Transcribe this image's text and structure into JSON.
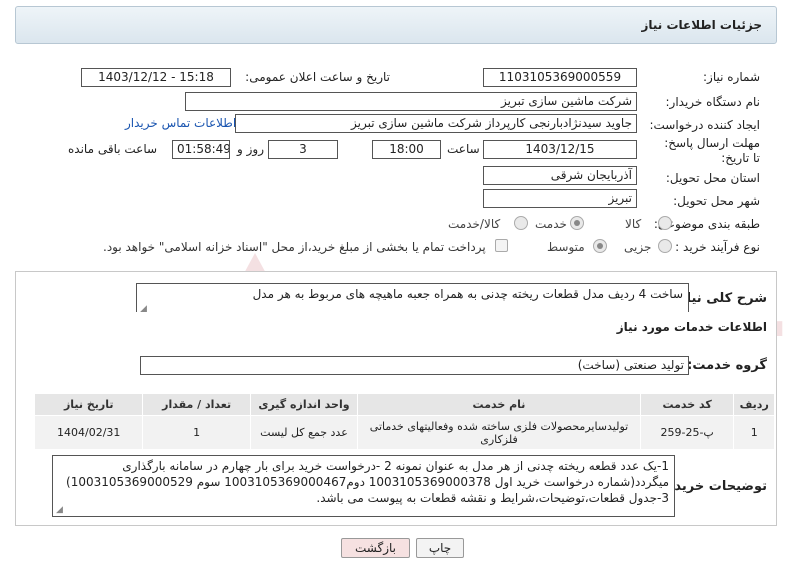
{
  "header": {
    "title": "جزئیات اطلاعات نیاز"
  },
  "fields": {
    "need_number_label": "شماره نیاز:",
    "need_number": "1103105369000559",
    "announce_label": "تاریخ و ساعت اعلان عمومی:",
    "announce_value": "1403/12/12 - 15:18",
    "buyer_org_label": "نام دستگاه خریدار:",
    "buyer_org": "شرکت ماشین سازی تبریز",
    "creator_label": "ایجاد کننده درخواست:",
    "creator": "جاوید سیدنژادبارنجی کارپرداز شرکت ماشین سازی تبریز",
    "contact_link": "اطلاعات تماس خریدار",
    "deadline_label": "مهلت ارسال پاسخ: تا تاریخ:",
    "deadline_date": "1403/12/15",
    "time_label": "ساعت",
    "deadline_time": "18:00",
    "days_value": "3",
    "days_label": "روز و",
    "remaining_time": "01:58:49",
    "remaining_label": "ساعت باقی مانده",
    "province_label": "استان محل تحویل:",
    "province": "آذربایجان شرقی",
    "city_label": "شهر محل تحویل:",
    "city": "تبریز",
    "category_label": "طبقه بندی موضوعی:",
    "category_options": [
      "کالا",
      "خدمت",
      "کالا/خدمت"
    ],
    "process_label": "نوع فرآیند خرید :",
    "process_options": [
      "جزیی",
      "متوسط"
    ],
    "payment_note": "پرداخت تمام یا بخشی از مبلغ خرید،از محل \"اسناد خزانه اسلامی\" خواهد بود."
  },
  "summary": {
    "label": "شرح کلی نیاز:",
    "text": "ساخت 4 ردیف مدل قطعات ریخته چدنی به همراه جعبه ماهیچه های مربوط به هر مدل"
  },
  "services": {
    "section_title": "اطلاعات خدمات مورد نیاز",
    "group_label": "گروه خدمت:",
    "group_value": "تولید صنعتی (ساخت)",
    "columns": [
      "ردیف",
      "کد خدمت",
      "نام خدمت",
      "واحد اندازه گیری",
      "تعداد / مقدار",
      "تاریخ نیاز"
    ],
    "rows": [
      [
        "1",
        "پ-25-259",
        "تولیدسایرمحصولات فلزی ساخته شده وفعالیتهای خدماتی فلزکاری",
        "عدد جمع کل لیست",
        "1",
        "1404/02/31"
      ]
    ]
  },
  "buyer_notes": {
    "label": "توضیحات خریدار:",
    "text": "1-یک عدد قطعه ریخته چدنی از هر مدل به عنوان نمونه 2 -درخواست خرید برای بار چهارم در سامانه بارگذاری میگردد(شماره درخواست خرید اول 1003105369000378 دوم1003105369000467 سوم 1003105369000529)  3-جدول قطعات،توضیحات،شرایط و نقشه قطعات به پیوست می باشد."
  },
  "buttons": {
    "back": "بازگشت",
    "print": "چاپ"
  },
  "watermark": "AriaTender.neT",
  "colors": {
    "link": "#1a55b0",
    "watermark": "#b0182c"
  }
}
